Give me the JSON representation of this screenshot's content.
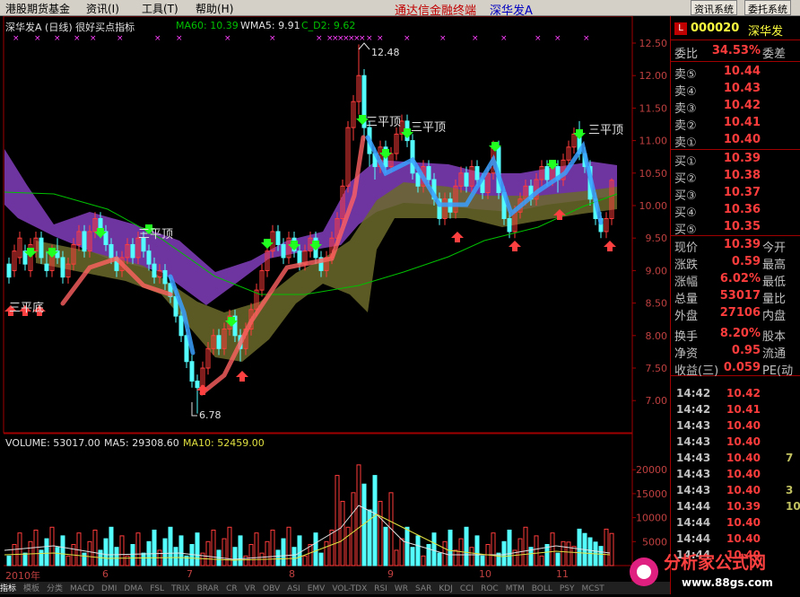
{
  "menu": {
    "items": [
      "港股期货基金",
      "资讯(I)",
      "工具(T)",
      "帮助(H)"
    ],
    "title": "通达信金融终端",
    "stock_title": "深华发A",
    "btn_info": "资讯系统",
    "btn_delegate": "委托系统"
  },
  "chart_header": {
    "name": "深华发A (日线) 很好买点指标",
    "ma60": "MA60: 10.39",
    "wma5": "WMA5: 9.91",
    "cd2": "C_D2: 9.62"
  },
  "annotations": {
    "high": "12.48",
    "low": "6.78",
    "bottom_label": "三平底",
    "top_label": "三平顶"
  },
  "volume_header": {
    "volume": "VOLUME: 53017.00",
    "ma5": "MA5: 29308.60",
    "ma10": "MA10: 52459.00"
  },
  "x_labels": [
    "2010年",
    "6",
    "7",
    "8",
    "9",
    "10",
    "11"
  ],
  "price_axis": [
    "12.50",
    "12.00",
    "11.50",
    "11.00",
    "10.50",
    "10.00",
    "9.50",
    "9.00",
    "8.50",
    "8.00",
    "7.50",
    "7.00"
  ],
  "volume_axis": [
    "20000",
    "15000",
    "10000",
    "5000"
  ],
  "bottom_tabs": [
    "指标",
    "模板",
    "分类",
    "MACD",
    "DMI",
    "DMA",
    "FSL",
    "TRIX",
    "BRAR",
    "CR",
    "VR",
    "OBV",
    "ASI",
    "EMV",
    "VOL-TDX",
    "RSI",
    "WR",
    "SAR",
    "KDJ",
    "CCI",
    "ROC",
    "MTM",
    "BOLL",
    "PSY",
    "MCST"
  ],
  "panel": {
    "code": "000020",
    "name": "深华发",
    "weibi_label": "委比",
    "weibi_value": "34.53%",
    "weicha_label": "委差",
    "sells": [
      {
        "label": "卖⑤",
        "price": "10.44"
      },
      {
        "label": "卖④",
        "price": "10.43"
      },
      {
        "label": "卖③",
        "price": "10.42"
      },
      {
        "label": "卖②",
        "price": "10.41"
      },
      {
        "label": "卖①",
        "price": "10.40"
      }
    ],
    "buys": [
      {
        "label": "买①",
        "price": "10.39"
      },
      {
        "label": "买②",
        "price": "10.38"
      },
      {
        "label": "买③",
        "price": "10.37"
      },
      {
        "label": "买④",
        "price": "10.36"
      },
      {
        "label": "买⑤",
        "price": "10.35"
      }
    ],
    "stats": [
      {
        "label": "现价",
        "value": "10.39",
        "extra": "今开"
      },
      {
        "label": "涨跌",
        "value": "0.59",
        "extra": "最高"
      },
      {
        "label": "涨幅",
        "value": "6.02%",
        "extra": "最低"
      },
      {
        "label": "总量",
        "value": "53017",
        "extra": "量比"
      },
      {
        "label": "外盘",
        "value": "27106",
        "extra": "内盘"
      },
      {
        "label": "换手",
        "value": "8.20%",
        "extra": "股本"
      },
      {
        "label": "净资",
        "value": "0.95",
        "extra": "流通"
      },
      {
        "label": "收益(三)",
        "value": "0.059",
        "extra": "PE(动"
      }
    ],
    "ticks": [
      {
        "time": "14:42",
        "price": "10.42",
        "vol": ""
      },
      {
        "time": "14:42",
        "price": "10.41",
        "vol": ""
      },
      {
        "time": "14:43",
        "price": "10.40",
        "vol": ""
      },
      {
        "time": "14:43",
        "price": "10.40",
        "vol": ""
      },
      {
        "time": "14:43",
        "price": "10.40",
        "vol": "7"
      },
      {
        "time": "14:43",
        "price": "10.40",
        "vol": ""
      },
      {
        "time": "14:43",
        "price": "10.40",
        "vol": "3"
      },
      {
        "time": "14:44",
        "price": "10.39",
        "vol": "10"
      },
      {
        "time": "14:44",
        "price": "10.40",
        "vol": ""
      },
      {
        "time": "14:44",
        "price": "10.40",
        "vol": ""
      },
      {
        "time": "14:44",
        "price": "10.40",
        "vol": ""
      }
    ]
  },
  "logo": {
    "text": "分析家公式网",
    "url": "www.88gs.com"
  },
  "colors": {
    "up": "#ff3c3c",
    "down": "#54ffff",
    "panel_border": "#a00000",
    "ma60": "#00c000"
  }
}
